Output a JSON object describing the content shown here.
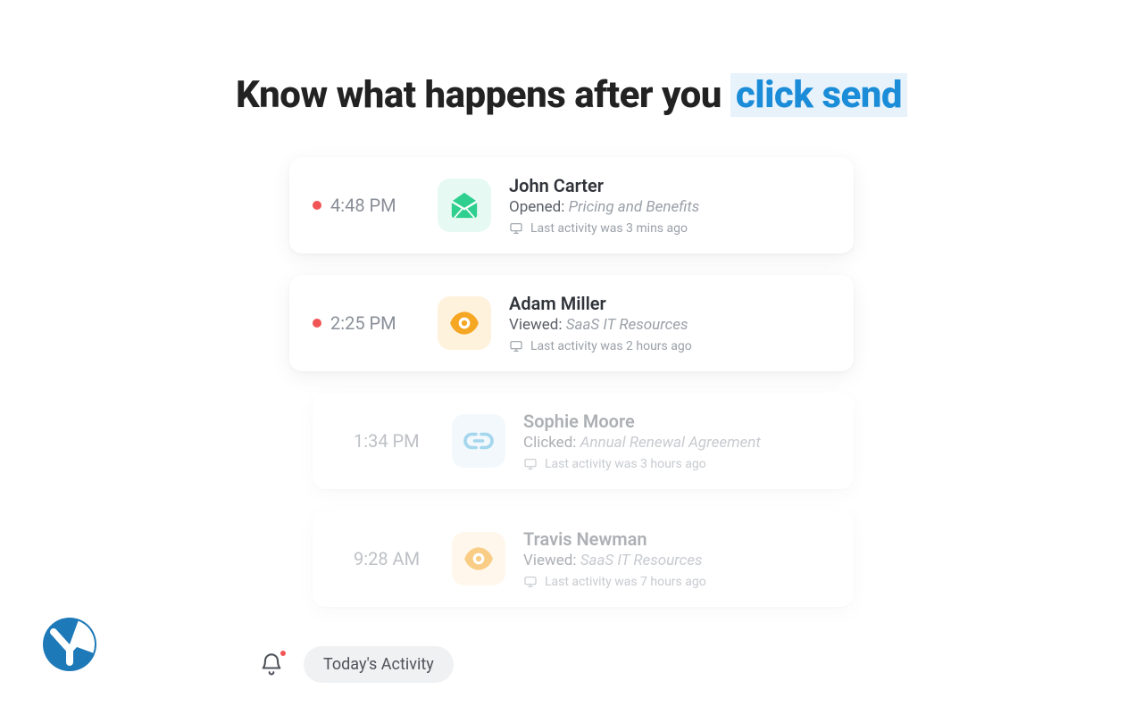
{
  "headline": {
    "prefix": "Know what happens after you ",
    "highlight": "click send"
  },
  "activities": [
    {
      "time": "4:48 PM",
      "unread": true,
      "icon": "open",
      "name": "John Carter",
      "action": "Opened:",
      "subject": "Pricing and Benefits",
      "meta": "Last activity was 3 mins ago",
      "faded": false
    },
    {
      "time": "2:25 PM",
      "unread": true,
      "icon": "view",
      "name": "Adam Miller",
      "action": "Viewed:",
      "subject": "SaaS IT Resources",
      "meta": "Last activity was 2 hours ago",
      "faded": false
    },
    {
      "time": "1:34 PM",
      "unread": false,
      "icon": "link",
      "name": "Sophie Moore",
      "action": "Clicked:",
      "subject": "Annual Renewal Agreement",
      "meta": "Last activity was 3 hours ago",
      "faded": true
    },
    {
      "time": "9:28 AM",
      "unread": false,
      "icon": "view",
      "name": "Travis Newman",
      "action": "Viewed:",
      "subject": "SaaS IT Resources",
      "meta": "Last activity was 7 hours ago",
      "faded": true
    }
  ],
  "footer": {
    "chip": "Today's Activity"
  }
}
